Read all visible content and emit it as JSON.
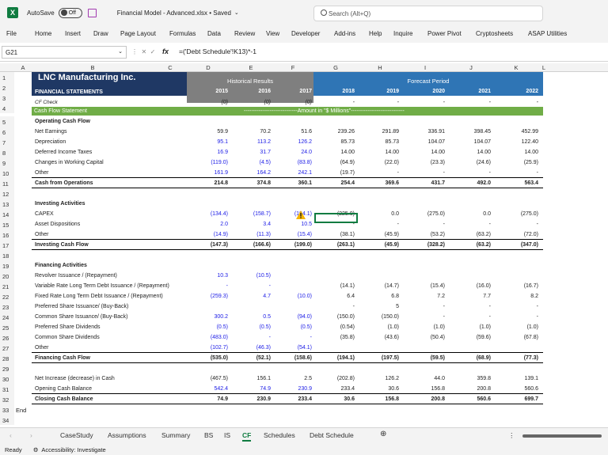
{
  "app": {
    "autosave": "AutoSave",
    "toggle": "Off",
    "file_title": "Financial Model - Advanced.xlsx • Saved",
    "search": "Search (Alt+Q)"
  },
  "menu": [
    "File",
    "Home",
    "Insert",
    "Draw",
    "Page Layout",
    "Formulas",
    "Data",
    "Review",
    "View",
    "Developer",
    "Add-ins",
    "Help",
    "Inquire",
    "Power Pivot",
    "Cryptosheets",
    "ASAP Utilities"
  ],
  "namebox": "G21",
  "formula": "=('Debt Schedule'!K13)*-1",
  "columns": [
    "A",
    "B",
    "C",
    "D",
    "E",
    "F",
    "G",
    "H",
    "I",
    "J",
    "K",
    "L"
  ],
  "header": {
    "company": "LNC Manufacturing Inc.",
    "subtitle": "FINANCIAL STATEMENTS",
    "hist": "Historical Results",
    "fcst": "Forecast Period",
    "cfcheck": "CF Check",
    "cfs": "Cash Flow Statement",
    "amount": "-----------------------------Amount in \"$ Millions\"-----------------------------"
  },
  "years": [
    "2015",
    "2016",
    "2017",
    "2018",
    "2019",
    "2020",
    "2021",
    "2022"
  ],
  "checks": [
    "(0)",
    "(0)",
    "(0)",
    "-",
    "-",
    "-",
    "-",
    "-"
  ],
  "rows": [
    {
      "n": "5",
      "label": "Operating Cash Flow",
      "bold": true,
      "vals": []
    },
    {
      "n": "6",
      "label": "Net Earnings",
      "vals": [
        "59.9",
        "70.2",
        "51.6",
        "239.26",
        "291.89",
        "336.91",
        "398.45",
        "452.99"
      ]
    },
    {
      "n": "7",
      "label": "Depreciation",
      "vals": [
        "95.1",
        "113.2",
        "126.2",
        "85.73",
        "85.73",
        "104.07",
        "104.07",
        "122.40"
      ],
      "blue": true
    },
    {
      "n": "8",
      "label": "Deferred Income Taxes",
      "vals": [
        "16.9",
        "31.7",
        "24.0",
        "14.00",
        "14.00",
        "14.00",
        "14.00",
        "14.00"
      ],
      "blue": true
    },
    {
      "n": "9",
      "label": "Changes in Working Capital",
      "vals": [
        "(119.0)",
        "(4.5)",
        "(83.8)",
        "(64.9)",
        "(22.0)",
        "(23.3)",
        "(24.6)",
        "(25.9)"
      ],
      "blue": true
    },
    {
      "n": "10",
      "label": "Other",
      "vals": [
        "161.9",
        "164.2",
        "242.1",
        "(19.7)",
        "-",
        "-",
        "-",
        "-"
      ],
      "blue": true
    },
    {
      "n": "11",
      "label": "Cash from Operations",
      "bold": true,
      "total": true,
      "vals": [
        "214.8",
        "374.8",
        "360.1",
        "254.4",
        "369.6",
        "431.7",
        "492.0",
        "563.4"
      ]
    },
    {
      "n": "12",
      "label": "",
      "vals": []
    },
    {
      "n": "13",
      "label": "Investing Activities",
      "bold": true,
      "vals": []
    },
    {
      "n": "14",
      "label": "CAPEX",
      "vals": [
        "(134.4)",
        "(158.7)",
        "(194.1)",
        "(225.0)",
        "0.0",
        "(275.0)",
        "0.0",
        "(275.0)"
      ],
      "blue": true
    },
    {
      "n": "15",
      "label": "Asset Dispositions",
      "vals": [
        "2.0",
        "3.4",
        "10.5",
        "-",
        "-",
        "-",
        "-",
        "-"
      ],
      "blue": true
    },
    {
      "n": "16",
      "label": "Other",
      "vals": [
        "(14.9)",
        "(11.3)",
        "(15.4)",
        "(38.1)",
        "(45.9)",
        "(53.2)",
        "(63.2)",
        "(72.0)"
      ],
      "blue": true
    },
    {
      "n": "17",
      "label": "Investing Cash Flow",
      "bold": true,
      "total": true,
      "vals": [
        "(147.3)",
        "(166.6)",
        "(199.0)",
        "(263.1)",
        "(45.9)",
        "(328.2)",
        "(63.2)",
        "(347.0)"
      ]
    },
    {
      "n": "18",
      "label": "",
      "vals": []
    },
    {
      "n": "19",
      "label": "Financing Activities",
      "bold": true,
      "vals": []
    },
    {
      "n": "20",
      "label": "Revolver Issuance / (Repayment)",
      "vals": [
        "10.3",
        "(10.5)",
        "",
        "",
        "",
        "",
        "",
        ""
      ],
      "blue": true
    },
    {
      "n": "21",
      "label": "Variable Rate Long Term Debt Issuance / (Repayment)",
      "vals": [
        "-",
        "-",
        "",
        "(14.1)",
        "(14.7)",
        "(15.4)",
        "(16.0)",
        "(16.7)"
      ],
      "blue": true
    },
    {
      "n": "22",
      "label": "Fixed Rate Long Term Debt Issuance / (Repayment)",
      "vals": [
        "(259.3)",
        "4.7",
        "(10.0)",
        "6.4",
        "6.8",
        "7.2",
        "7.7",
        "8.2"
      ],
      "blue": true
    },
    {
      "n": "23",
      "label": "Preferred Share Issuance/ (Buy-Back)",
      "vals": [
        "",
        "",
        "",
        "-",
        "5",
        "-",
        "-",
        "-"
      ],
      "blue": true
    },
    {
      "n": "24",
      "label": "Common Share Issuance/ (Buy-Back)",
      "vals": [
        "300.2",
        "0.5",
        "(94.0)",
        "(150.0)",
        "(150.0)",
        "-",
        "-",
        "-"
      ],
      "blue": true
    },
    {
      "n": "25",
      "label": "Preferred Share Dividends",
      "vals": [
        "(0.5)",
        "(0.5)",
        "(0.5)",
        "(0.54)",
        "(1.0)",
        "(1.0)",
        "(1.0)",
        "(1.0)"
      ],
      "blue": true
    },
    {
      "n": "26",
      "label": "Common Share Dividends",
      "vals": [
        "(483.0)",
        "-",
        "-",
        "(35.8)",
        "(43.6)",
        "(50.4)",
        "(59.6)",
        "(67.8)"
      ],
      "blue": true
    },
    {
      "n": "27",
      "label": "Other",
      "vals": [
        "(102.7)",
        "(46.3)",
        "(54.1)",
        "",
        "",
        "",
        "",
        ""
      ],
      "blue": true
    },
    {
      "n": "28",
      "label": "Financing Cash Flow",
      "bold": true,
      "total": true,
      "vals": [
        "(535.0)",
        "(52.1)",
        "(158.6)",
        "(194.1)",
        "(197.5)",
        "(59.5)",
        "(68.9)",
        "(77.3)"
      ]
    },
    {
      "n": "29",
      "label": "",
      "vals": []
    },
    {
      "n": "30",
      "label": "Net Increase (decrease) in Cash",
      "vals": [
        "(467.5)",
        "156.1",
        "2.5",
        "(202.8)",
        "126.2",
        "44.0",
        "359.8",
        "139.1"
      ]
    },
    {
      "n": "31",
      "label": "Opening Cash Balance",
      "vals": [
        "542.4",
        "74.9",
        "230.9",
        "233.4",
        "30.6",
        "156.8",
        "200.8",
        "560.6"
      ],
      "blue": true
    },
    {
      "n": "32",
      "label": "Closing Cash Balance",
      "bold": true,
      "total": true,
      "vals": [
        "74.9",
        "230.9",
        "233.4",
        "30.6",
        "156.8",
        "200.8",
        "560.6",
        "699.7"
      ]
    },
    {
      "n": "33",
      "label": "End",
      "vals": []
    },
    {
      "n": "34",
      "label": "",
      "vals": []
    }
  ],
  "sheets": [
    "CaseStudy",
    "Assumptions",
    "Summary",
    "BS",
    "IS",
    "CF",
    "Schedules",
    "Debt Schedule"
  ],
  "active_sheet": "CF",
  "status": {
    "ready": "Ready",
    "access": "Accessibility: Investigate"
  }
}
